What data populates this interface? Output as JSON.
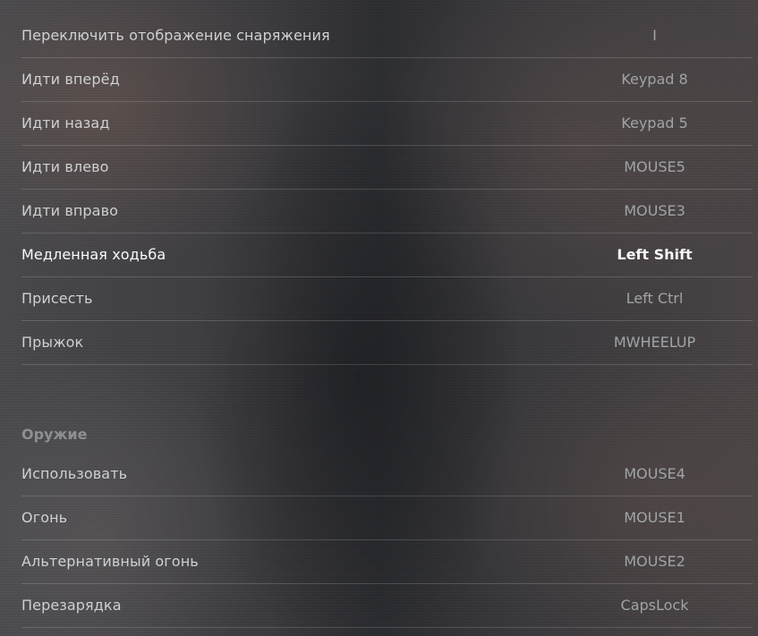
{
  "movement_bindings": [
    {
      "action": "Переключить отображение снаряжения",
      "key": "I"
    },
    {
      "action": "Идти вперёд",
      "key": "Keypad 8"
    },
    {
      "action": "Идти назад",
      "key": "Keypad 5"
    },
    {
      "action": "Идти влево",
      "key": "MOUSE5"
    },
    {
      "action": "Идти вправо",
      "key": "MOUSE3"
    },
    {
      "action": "Медленная ходьба",
      "key": "Left Shift"
    },
    {
      "action": "Присесть",
      "key": "Left Ctrl"
    },
    {
      "action": "Прыжок",
      "key": "MWHEELUP"
    }
  ],
  "weapons_section": {
    "title": "Оружие",
    "bindings": [
      {
        "action": "Использовать",
        "key": "MOUSE4"
      },
      {
        "action": "Огонь",
        "key": "MOUSE1"
      },
      {
        "action": "Альтернативный огонь",
        "key": "MOUSE2"
      },
      {
        "action": "Перезарядка",
        "key": "CapsLock"
      }
    ]
  },
  "selected_action": "Медленная ходьба",
  "colors": {
    "text_primary": "#d2d4d6",
    "text_key": "#a4a7aa",
    "text_selected": "#ffffff",
    "section_header": "#8f9295",
    "divider": "rgba(255,255,255,0.16)"
  }
}
